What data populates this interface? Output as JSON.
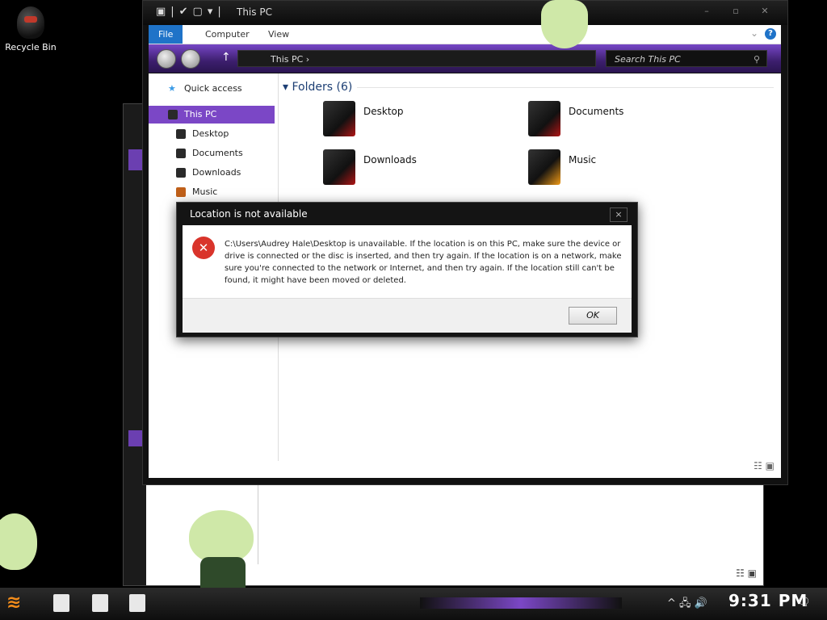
{
  "desktop": {
    "recycle_bin_label": "Recycle Bin"
  },
  "explorer": {
    "title": "This PC",
    "ribbon_tabs": [
      "File",
      "Computer",
      "View"
    ],
    "address": "This PC",
    "search_placeholder": "Search This PC",
    "nav": {
      "quick_access": "Quick access",
      "this_pc": "This PC",
      "items": [
        "Desktop",
        "Documents",
        "Downloads",
        "Music"
      ]
    },
    "folders_header": "Folders (6)",
    "folders": [
      "Desktop",
      "Documents",
      "Downloads",
      "Music"
    ]
  },
  "dialog": {
    "title": "Location is not available",
    "close": "×",
    "message": "C:\\Users\\Audrey Hale\\Desktop is unavailable. If the location is on this PC, make sure the device or drive is connected or the disc is inserted, and then try again. If the location is on a network, make sure you're connected to the network or Internet, and then try again. If the location still can't be found, it might have been moved or deleted.",
    "ok": "OK"
  },
  "taskbar": {
    "clock": "9:31 PM"
  },
  "colors": {
    "accent_purple": "#7b47c6",
    "ribbon_blue": "#1f73c8",
    "error_red": "#d9342b"
  }
}
